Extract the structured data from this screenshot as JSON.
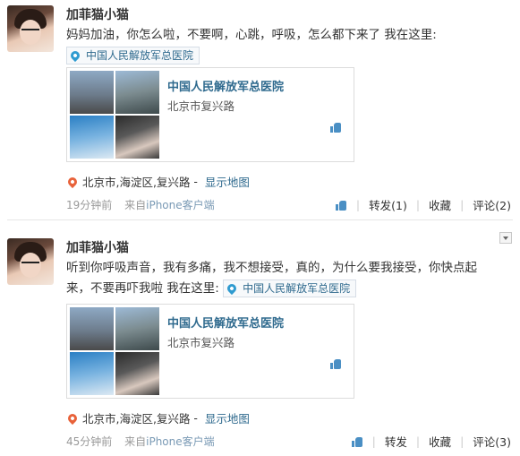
{
  "posts": [
    {
      "author": "加菲猫小猫",
      "text": "妈妈加油，你怎么啦，不要啊，心跳，呼吸，怎么都下来了 我在这里:",
      "location_tag": "中国人民解放军总医院",
      "card": {
        "title": "中国人民解放军总医院",
        "address": "北京市复兴路"
      },
      "location_line": {
        "place": "北京市,海淀区,复兴路",
        "sep": " - ",
        "show_map": "显示地图"
      },
      "time": "19分钟前",
      "from_label": "来自",
      "from_app": "iPhone客户端",
      "actions": {
        "repost": "转发(1)",
        "favorite": "收藏",
        "comment": "评论(2)"
      }
    },
    {
      "author": "加菲猫小猫",
      "text_line1": "听到你呼吸声音，我有多痛，我不想接受，真的，为什么要我接受，你快点起",
      "text_line2": "来，不要再吓我啦 我在这里:",
      "location_tag": "中国人民解放军总医院",
      "card": {
        "title": "中国人民解放军总医院",
        "address": "北京市复兴路"
      },
      "location_line": {
        "place": "北京市,海淀区,复兴路",
        "sep": " - ",
        "show_map": "显示地图"
      },
      "time": "45分钟前",
      "from_label": "来自",
      "from_app": "iPhone客户端",
      "actions": {
        "repost": "转发",
        "favorite": "收藏",
        "comment": "评论(3)"
      }
    }
  ],
  "icons": {
    "location_pin_blue": "location-pin-icon",
    "location_pin_orange": "location-pin-icon",
    "like": "thumbs-up-icon",
    "dropdown": "chevron-down-icon"
  },
  "colors": {
    "link": "#2f6a8e",
    "meta": "#999999",
    "pin_orange": "#e8623a",
    "like_blue": "#4a8fc4"
  }
}
